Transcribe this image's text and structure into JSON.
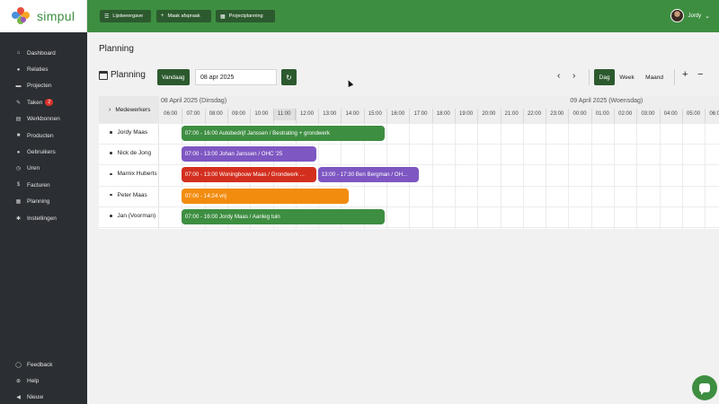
{
  "brand": {
    "name": "simpul"
  },
  "sidebar": {
    "items": [
      {
        "label": "Dashboard",
        "icon": "home-icon",
        "glyph": "⌂"
      },
      {
        "label": "Relaties",
        "icon": "user-icon",
        "glyph": "●"
      },
      {
        "label": "Projecten",
        "icon": "folder-icon",
        "glyph": "▬"
      },
      {
        "label": "Taken",
        "icon": "pin-icon",
        "glyph": "✎",
        "badge": "2"
      },
      {
        "label": "Werkbonnen",
        "icon": "document-icon",
        "glyph": "▤"
      },
      {
        "label": "Producten",
        "icon": "box-icon",
        "glyph": "■"
      },
      {
        "label": "Gebruikers",
        "icon": "users-icon",
        "glyph": "●"
      },
      {
        "label": "Uren",
        "icon": "clock-icon",
        "glyph": "◷"
      },
      {
        "label": "Facturen",
        "icon": "dollar-icon",
        "glyph": "$"
      },
      {
        "label": "Planning",
        "icon": "calendar-icon",
        "glyph": "▦"
      },
      {
        "label": "Instellingen",
        "icon": "gear-icon",
        "glyph": "✱"
      }
    ],
    "bottom": [
      {
        "label": "Feedback",
        "icon": "comment-icon",
        "glyph": "◯"
      },
      {
        "label": "Help",
        "icon": "help-icon",
        "glyph": "⊕"
      },
      {
        "label": "Nieuw",
        "icon": "megaphone-icon",
        "glyph": "◀"
      }
    ]
  },
  "topbar": {
    "buttons": [
      {
        "label": "Lijstweergave",
        "icon": "list-icon",
        "glyph": "☰"
      },
      {
        "label": "Maak afspraak",
        "icon": "plus-icon",
        "glyph": "+"
      },
      {
        "label": "Projectplanning",
        "icon": "calendar-icon",
        "glyph": "▦"
      }
    ],
    "user": {
      "name": "Jordy",
      "chevron": "⌄"
    }
  },
  "page": {
    "title": "Planning"
  },
  "toolbar": {
    "title": "Planning",
    "today_label": "Vandaag",
    "date_value": "08 apr 2025",
    "refresh_glyph": "↻",
    "prev_glyph": "‹",
    "next_glyph": "›",
    "views": [
      "Dag",
      "Week",
      "Maand"
    ],
    "active_view": "Dag",
    "plus_glyph": "+",
    "minus_glyph": "−"
  },
  "timeline": {
    "resource_header": "Medewerkers",
    "expand_glyph": "›",
    "days": [
      {
        "label": "08 April 2025 (Dinsdag)",
        "start_hour_index": 0
      },
      {
        "label": "09 April 2025 (Woensdag)",
        "start_hour_index": 18
      }
    ],
    "hours": [
      "06:00",
      "07:00",
      "08:00",
      "09:00",
      "10:00",
      "11:00",
      "12:00",
      "13:00",
      "14:00",
      "15:00",
      "16:00",
      "17:00",
      "18:00",
      "19:00",
      "20:00",
      "21:00",
      "22:00",
      "23:00",
      "00:00",
      "01:00",
      "02:00",
      "03:00",
      "04:00",
      "05:00",
      "06:00"
    ],
    "current_hour_index": 5,
    "resources": [
      "Jordy Maas",
      "Nick de Jong",
      "Marnix Huberts",
      "Peter Maas",
      "Jan (Voorman)"
    ],
    "events": [
      {
        "row": 0,
        "start": 7,
        "end": 16,
        "label": "07:00 - 16:00 Autobedrijf Janssen / Bestrating + grondwerk",
        "color": "#3e8e41"
      },
      {
        "row": 1,
        "start": 7,
        "end": 13,
        "label": "07:00 - 13:00 Johan Janssen / OHC '25",
        "color": "#7e57c2"
      },
      {
        "row": 2,
        "start": 7,
        "end": 13,
        "label": "07:00 - 13:00 Woningbouw Maas / Grondwerk ...",
        "color": "#d32f1f"
      },
      {
        "row": 2,
        "start": 13,
        "end": 17.5,
        "label": "13:00 - 17:30 Ben Bergman / OH...",
        "color": "#7e57c2"
      },
      {
        "row": 3,
        "start": 7,
        "end": 14.4,
        "label": "07:00 - 14:24 vrij",
        "color": "#f28c0f"
      },
      {
        "row": 4,
        "start": 7,
        "end": 16,
        "label": "07:00 - 16:00 Jordy Maas / Aanleg tuin",
        "color": "#3e8e41"
      }
    ]
  },
  "colors": {
    "brand_green": "#3e8e41",
    "dark_green": "#2c5a2e",
    "sidebar_bg": "#2b2e33"
  }
}
